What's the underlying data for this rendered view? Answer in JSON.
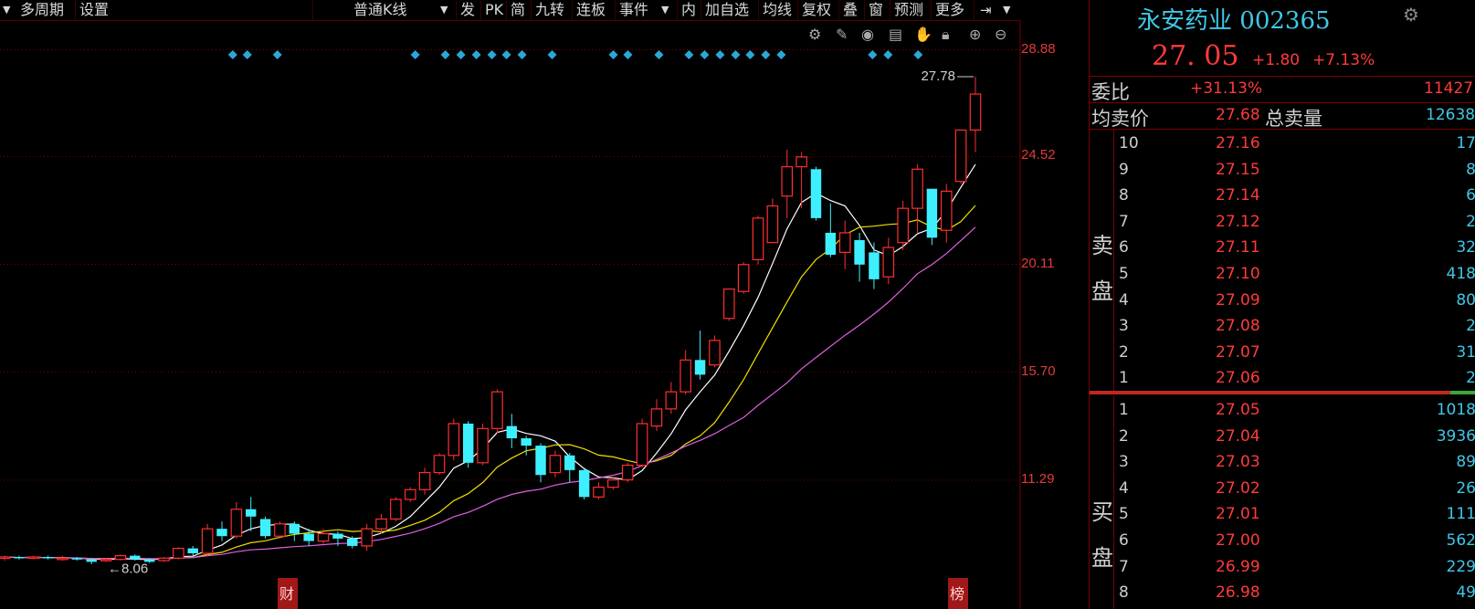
{
  "toolbar": {
    "items": [
      "多周期",
      "设置",
      "普通K线",
      "发",
      "PK",
      "简",
      "九转",
      "连板",
      "事件",
      "内",
      "加自选",
      "均线",
      "复权",
      "叠",
      "窗",
      "预测",
      "更多"
    ]
  },
  "chart_data": {
    "type": "candlestick",
    "y_ticks": [
      "28.88",
      "24.52",
      "20.11",
      "15.70",
      "11.29"
    ],
    "ylim": [
      8.0,
      28.9
    ],
    "annotations": {
      "high_label": "27.78",
      "low_label": "←8.06",
      "bottom_marks": [
        "财",
        "榜"
      ]
    },
    "candles": [
      [
        8.1,
        8.15,
        8.0,
        8.2
      ],
      [
        8.15,
        8.1,
        8.05,
        8.2
      ],
      [
        8.1,
        8.15,
        8.05,
        8.2
      ],
      [
        8.15,
        8.1,
        8.05,
        8.2
      ],
      [
        8.1,
        8.1,
        8.0,
        8.2
      ],
      [
        8.1,
        8.05,
        8.0,
        8.15
      ],
      [
        8.05,
        7.95,
        7.85,
        8.1
      ],
      [
        8.0,
        8.05,
        7.95,
        8.1
      ],
      [
        8.05,
        8.2,
        8.0,
        8.25
      ],
      [
        8.2,
        8.05,
        8.0,
        8.25
      ],
      [
        8.05,
        7.95,
        7.9,
        8.1
      ],
      [
        8.0,
        8.1,
        7.95,
        8.15
      ],
      [
        8.1,
        8.5,
        8.05,
        8.55
      ],
      [
        8.5,
        8.3,
        8.2,
        8.6
      ],
      [
        8.3,
        9.3,
        8.2,
        9.5
      ],
      [
        9.3,
        9.0,
        8.8,
        9.6
      ],
      [
        9.0,
        10.1,
        8.9,
        10.4
      ],
      [
        10.1,
        9.8,
        9.2,
        10.6
      ],
      [
        9.7,
        9.0,
        8.9,
        9.8
      ],
      [
        9.0,
        9.5,
        8.9,
        9.6
      ],
      [
        9.5,
        9.1,
        8.8,
        9.6
      ],
      [
        9.1,
        8.8,
        8.6,
        9.3
      ],
      [
        8.8,
        9.1,
        8.7,
        9.3
      ],
      [
        9.1,
        8.9,
        8.6,
        9.2
      ],
      [
        8.9,
        8.6,
        8.5,
        9.0
      ],
      [
        8.6,
        9.3,
        8.4,
        9.5
      ],
      [
        9.3,
        9.7,
        9.1,
        9.9
      ],
      [
        9.7,
        10.5,
        9.6,
        10.6
      ],
      [
        10.5,
        10.9,
        10.4,
        11.0
      ],
      [
        10.9,
        11.6,
        10.7,
        11.8
      ],
      [
        11.6,
        12.3,
        11.5,
        12.4
      ],
      [
        12.3,
        13.6,
        12.1,
        13.8
      ],
      [
        13.6,
        12.0,
        11.8,
        13.7
      ],
      [
        12.0,
        13.4,
        11.9,
        13.6
      ],
      [
        13.4,
        14.9,
        13.2,
        15.0
      ],
      [
        13.5,
        13.0,
        12.6,
        14.0
      ],
      [
        13.0,
        12.7,
        12.3,
        13.1
      ],
      [
        12.7,
        11.5,
        11.2,
        12.8
      ],
      [
        11.6,
        12.3,
        11.4,
        12.5
      ],
      [
        12.3,
        11.7,
        11.2,
        12.4
      ],
      [
        11.7,
        10.6,
        10.5,
        11.8
      ],
      [
        10.6,
        11.0,
        10.5,
        11.2
      ],
      [
        11.0,
        11.3,
        10.9,
        11.4
      ],
      [
        11.3,
        11.9,
        11.2,
        12.0
      ],
      [
        11.9,
        13.6,
        11.8,
        13.8
      ],
      [
        13.5,
        14.2,
        13.3,
        14.6
      ],
      [
        14.2,
        14.9,
        14.0,
        15.3
      ],
      [
        14.9,
        16.2,
        14.8,
        16.6
      ],
      [
        16.2,
        15.6,
        15.4,
        17.4
      ],
      [
        16.0,
        17.0,
        15.9,
        17.2
      ],
      [
        17.9,
        19.1,
        17.8,
        19.1
      ],
      [
        19.0,
        20.1,
        18.9,
        20.2
      ],
      [
        20.3,
        22.0,
        20.1,
        22.1
      ],
      [
        21.0,
        22.5,
        21.0,
        22.8
      ],
      [
        22.9,
        24.1,
        22.0,
        24.8
      ],
      [
        24.1,
        24.5,
        22.4,
        24.7
      ],
      [
        24.0,
        22.0,
        21.9,
        24.1
      ],
      [
        21.4,
        20.5,
        20.4,
        22.6
      ],
      [
        20.6,
        21.4,
        19.9,
        21.9
      ],
      [
        21.1,
        20.1,
        19.4,
        21.4
      ],
      [
        20.6,
        19.5,
        19.1,
        21.0
      ],
      [
        19.6,
        20.8,
        19.3,
        21.2
      ],
      [
        21.0,
        22.4,
        20.7,
        22.7
      ],
      [
        22.4,
        24.0,
        21.4,
        24.2
      ],
      [
        23.2,
        21.2,
        20.9,
        23.2
      ],
      [
        21.5,
        23.1,
        21.0,
        23.4
      ],
      [
        23.5,
        25.6,
        23.4,
        25.6
      ],
      [
        25.6,
        27.07,
        24.7,
        27.78
      ]
    ],
    "markers_x_pct": [
      23.5,
      25.0,
      28.1,
      42.3,
      45.4,
      47.0,
      48.6,
      50.2,
      51.7,
      53.3,
      56.4,
      62.7,
      64.2,
      67.4,
      70.5,
      72.1,
      73.7,
      75.3,
      76.8,
      78.4,
      80.0,
      89.4,
      91.0,
      94.1
    ]
  },
  "quote": {
    "name": "永安药业",
    "code": "002365",
    "price": "27. 05",
    "change": "+1.80",
    "pct": "+7.13%",
    "weibi_label": "委比",
    "weibi": "+31.13%",
    "weicha": "11427",
    "avg_sell_label": "均卖价",
    "avg_sell": "27.68",
    "total_sell_label": "总卖量",
    "total_sell": "12638",
    "sell_side": "卖盘",
    "buy_side": "买盘"
  },
  "asks": [
    {
      "n": "10",
      "p": "27.16",
      "v": "17"
    },
    {
      "n": "9",
      "p": "27.15",
      "v": "8"
    },
    {
      "n": "8",
      "p": "27.14",
      "v": "6"
    },
    {
      "n": "7",
      "p": "27.12",
      "v": "2"
    },
    {
      "n": "6",
      "p": "27.11",
      "v": "32"
    },
    {
      "n": "5",
      "p": "27.10",
      "v": "418"
    },
    {
      "n": "4",
      "p": "27.09",
      "v": "80"
    },
    {
      "n": "3",
      "p": "27.08",
      "v": "2"
    },
    {
      "n": "2",
      "p": "27.07",
      "v": "31"
    },
    {
      "n": "1",
      "p": "27.06",
      "v": "2"
    }
  ],
  "bids": [
    {
      "n": "1",
      "p": "27.05",
      "v": "1018"
    },
    {
      "n": "2",
      "p": "27.04",
      "v": "3936"
    },
    {
      "n": "3",
      "p": "27.03",
      "v": "89"
    },
    {
      "n": "4",
      "p": "27.02",
      "v": "26"
    },
    {
      "n": "5",
      "p": "27.01",
      "v": "111"
    },
    {
      "n": "6",
      "p": "27.00",
      "v": "562"
    },
    {
      "n": "7",
      "p": "26.99",
      "v": "229"
    },
    {
      "n": "8",
      "p": "26.98",
      "v": "49"
    }
  ],
  "colors": {
    "up": "#ff2e2e",
    "down": "#3ef0ff",
    "ma5": "#ffffff",
    "ma10": "#f0e000",
    "ma20": "#e060e0",
    "marker": "#2aa8d8"
  }
}
